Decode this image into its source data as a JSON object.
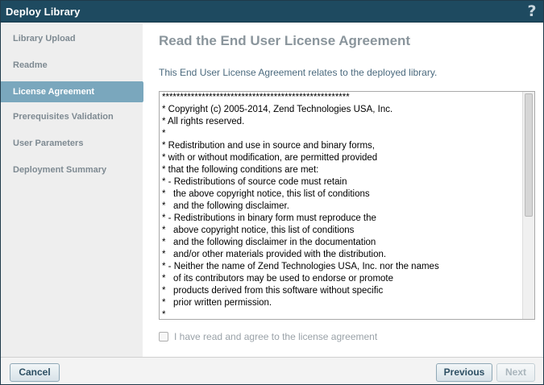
{
  "window": {
    "title": "Deploy Library",
    "help_glyph": "?"
  },
  "sidebar": {
    "steps": [
      {
        "label": "Library Upload"
      },
      {
        "label": "Readme"
      },
      {
        "label": "License Agreement"
      },
      {
        "label": "Prerequisites Validation"
      },
      {
        "label": "User Parameters"
      },
      {
        "label": "Deployment Summary"
      }
    ],
    "active_step": "License Agreement"
  },
  "main": {
    "heading": "Read the End User License Agreement",
    "subtext": "This End User License Agreement relates to the deployed library.",
    "license_lines": [
      "****************************************************",
      "* Copyright (c) 2005-2014, Zend Technologies USA, Inc.",
      "* All rights reserved.",
      "*",
      "* Redistribution and use in source and binary forms,",
      "* with or without modification, are permitted provided",
      "* that the following conditions are met:",
      "* - Redistributions of source code must retain",
      "*   the above copyright notice, this list of conditions",
      "*   and the following disclaimer.",
      "* - Redistributions in binary form must reproduce the",
      "*   above copyright notice, this list of conditions",
      "*   and the following disclaimer in the documentation",
      "*   and/or other materials provided with the distribution.",
      "* - Neither the name of Zend Technologies USA, Inc. nor the names",
      "*   of its contributors may be used to endorse or promote",
      "*   products derived from this software without specific",
      "*   prior written permission.",
      "*"
    ],
    "agree_label": "I have read and agree to the license agreement",
    "agree_checked": false
  },
  "footer": {
    "cancel_label": "Cancel",
    "previous_label": "Previous",
    "next_label": "Next"
  },
  "colors": {
    "titlebar": "#1e4a60",
    "active_step": "#7aa7bd",
    "heading": "#8a959c",
    "subtext": "#4b6a7e"
  }
}
